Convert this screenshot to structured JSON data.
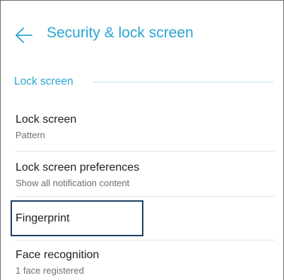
{
  "header": {
    "back_icon": "arrow-left-icon",
    "title": "Security & lock screen"
  },
  "section": {
    "label": "Lock screen"
  },
  "items": [
    {
      "title": "Lock screen",
      "subtitle": "Pattern"
    },
    {
      "title": "Lock screen preferences",
      "subtitle": "Show all notification content"
    },
    {
      "title": "Fingerprint",
      "subtitle": ""
    },
    {
      "title": "Face recognition",
      "subtitle": "1 face registered"
    }
  ],
  "colors": {
    "accent": "#2aa6cf",
    "title_text": "#202020",
    "secondary_text": "#6f6f6f",
    "divider": "#e6e6e6",
    "highlight_border": "#1b3f63"
  }
}
